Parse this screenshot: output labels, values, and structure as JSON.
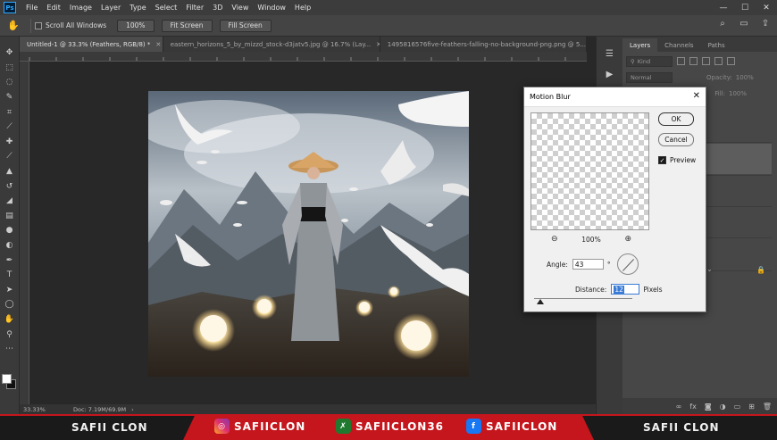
{
  "menubar": {
    "app_icon": "Ps",
    "items": [
      "File",
      "Edit",
      "Image",
      "Layer",
      "Type",
      "Select",
      "Filter",
      "3D",
      "View",
      "Window",
      "Help"
    ]
  },
  "options": {
    "scroll_all_label": "Scroll All Windows",
    "zoom_btn": "100%",
    "fit_btn": "Fit Screen",
    "fill_btn": "Fill Screen"
  },
  "tabs": [
    {
      "label": "Untitled-1 @ 33.3% (Feathers, RGB/8) *",
      "active": true
    },
    {
      "label": "eastern_horizons_5_by_mizzd_stock-d3jatv5.jpg @ 16.7% (Lay...",
      "active": false
    },
    {
      "label": "1495816576five-feathers-falling-no-background-png.png @ 5...",
      "active": false
    }
  ],
  "status": {
    "zoom": "33.33%",
    "doc": "Doc: 7.19M/69.9M"
  },
  "layers_panel": {
    "tabs": [
      "Layers",
      "Channels",
      "Paths"
    ],
    "kind": "Kind",
    "blend": "Normal",
    "opacity_label": "Opacity:",
    "opacity_value": "100%",
    "fill_label": "Fill:",
    "fill_value": "100%"
  },
  "dialog": {
    "title": "Motion Blur",
    "ok": "OK",
    "cancel": "Cancel",
    "preview_label": "Preview",
    "preview_checked": true,
    "zoom": "100%",
    "angle_label": "Angle:",
    "angle_value": "43",
    "angle_unit": "°",
    "distance_label": "Distance:",
    "distance_value": "12",
    "distance_unit": "Pixels"
  },
  "banner": {
    "left_name": "SAFII CLON",
    "instagram": "SAFIICLON",
    "other": "SAFIICLON36",
    "facebook": "SAFIICLON",
    "right_name": "SAFII CLON"
  },
  "colors": {
    "accent": "#3a7bd5",
    "banner_red": "#c4161c"
  }
}
